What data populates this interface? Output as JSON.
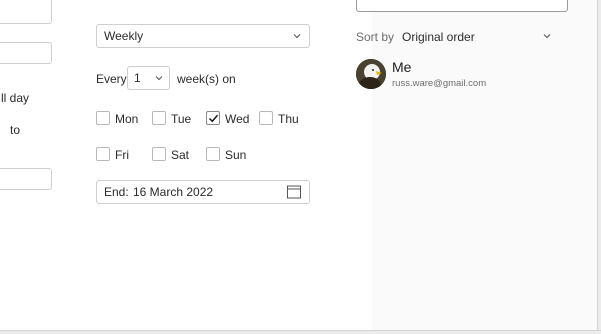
{
  "recurrence": {
    "frequency": "Weekly",
    "every_label": "Every",
    "every_value": "1",
    "unit_label": "week(s) on",
    "days": [
      {
        "label": "Mon",
        "checked": false
      },
      {
        "label": "Tue",
        "checked": false
      },
      {
        "label": "Wed",
        "checked": true
      },
      {
        "label": "Thu",
        "checked": false
      },
      {
        "label": "Fri",
        "checked": false
      },
      {
        "label": "Sat",
        "checked": false
      },
      {
        "label": "Sun",
        "checked": false
      }
    ],
    "end_label": "End:",
    "end_date": "16 March 2022"
  },
  "left": {
    "all_day_partial": "ll day",
    "to_label": "to"
  },
  "attendees": {
    "sort_label": "Sort by",
    "sort_value": "Original order",
    "items": [
      {
        "name": "Me",
        "email": "russ.ware@gmail.com"
      }
    ]
  },
  "colors": {
    "border": "#cfcfcf",
    "text": "#2b2b2b",
    "muted": "#6d6d6d",
    "accent": "#1a1a1a"
  }
}
